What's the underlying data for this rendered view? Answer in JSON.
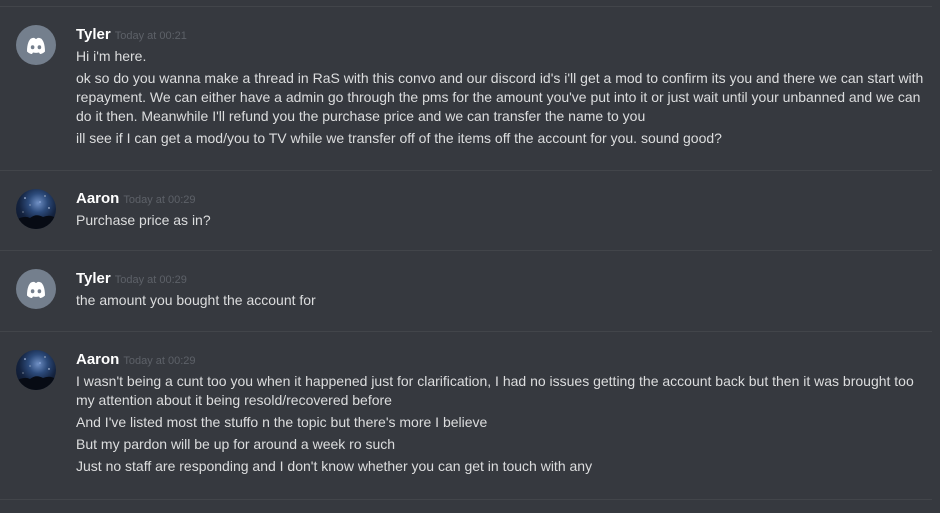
{
  "messages": [
    {
      "author": "Tyler",
      "timestamp": "Today at 00:21",
      "avatar": "discord-logo-icon",
      "lines": [
        "Hi i'm here.",
        "ok so do you wanna make a thread in RaS with  this convo and our discord id's i'll get a mod to confirm its you and there we can start with repayment. We can either have a admin go through the pms for the amount you've put into it or just wait until your unbanned and we can do it then. Meanwhile I'll refund you the purchase price  and we can transfer the name to you",
        "ill see if I can get a mod/you to TV while we transfer off of the items off the account for you. sound good?"
      ]
    },
    {
      "author": "Aaron",
      "timestamp": "Today at 00:29",
      "avatar": "space-avatar",
      "lines": [
        "Purchase price as in?"
      ]
    },
    {
      "author": "Tyler",
      "timestamp": "Today at 00:29",
      "avatar": "discord-logo-icon",
      "lines": [
        "the amount you bought the account for"
      ]
    },
    {
      "author": "Aaron",
      "timestamp": "Today at 00:29",
      "avatar": "space-avatar",
      "lines": [
        "I wasn't being a cunt too you when it happened just for clarification, I had no issues getting the account back but then it was brought too my attention about it being resold/recovered before",
        "And I've listed most the stuffo n the topic but there's more I believe",
        "But my pardon will be up for around a week ro such",
        "Just no staff are responding and I don't know whether you can get in touch with any"
      ]
    }
  ],
  "colors": {
    "background": "#36393f",
    "divider": "#42454a",
    "username": "#ffffff",
    "timestamp": "#5d6168",
    "text": "#dcddde",
    "default_avatar": "#747f8d"
  }
}
